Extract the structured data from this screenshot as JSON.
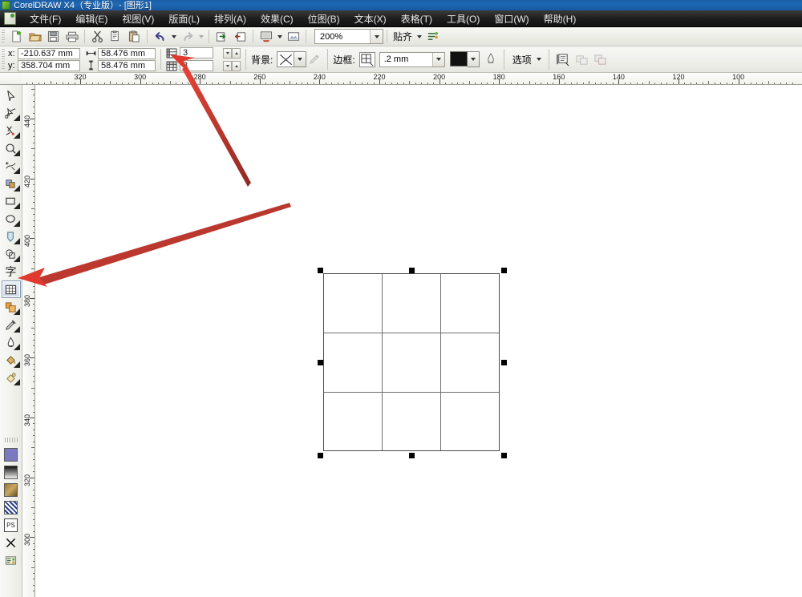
{
  "window": {
    "title": "CorelDRAW X4（专业版）- [图形1]",
    "app_icon": "coreldraw-icon",
    "titlebar_color": "#1f68b4"
  },
  "menubar": {
    "items": [
      {
        "label": "文件(F)",
        "name": "menu-file"
      },
      {
        "label": "编辑(E)",
        "name": "menu-edit"
      },
      {
        "label": "视图(V)",
        "name": "menu-view"
      },
      {
        "label": "版面(L)",
        "name": "menu-layout"
      },
      {
        "label": "排列(A)",
        "name": "menu-arrange"
      },
      {
        "label": "效果(C)",
        "name": "menu-effects"
      },
      {
        "label": "位图(B)",
        "name": "menu-bitmaps"
      },
      {
        "label": "文本(X)",
        "name": "menu-text"
      },
      {
        "label": "表格(T)",
        "name": "menu-table"
      },
      {
        "label": "工具(O)",
        "name": "menu-tools"
      },
      {
        "label": "窗口(W)",
        "name": "menu-window"
      },
      {
        "label": "帮助(H)",
        "name": "menu-help"
      }
    ]
  },
  "toolbar": {
    "buttons": [
      {
        "name": "new-document-button",
        "icon": "new-doc-icon"
      },
      {
        "name": "open-document-button",
        "icon": "folder-open-icon"
      },
      {
        "name": "save-button",
        "icon": "floppy-disk-icon"
      },
      {
        "name": "print-button",
        "icon": "printer-icon"
      },
      {
        "name": "cut-button",
        "icon": "scissors-icon"
      },
      {
        "name": "copy-button",
        "icon": "copy-icon"
      },
      {
        "name": "paste-button",
        "icon": "paste-icon"
      },
      {
        "name": "undo-button",
        "icon": "undo-arrow-icon"
      },
      {
        "name": "redo-button",
        "icon": "redo-arrow-icon"
      },
      {
        "name": "import-button",
        "icon": "import-icon"
      },
      {
        "name": "export-button",
        "icon": "export-icon"
      },
      {
        "name": "application-launcher-button",
        "icon": "launcher-icon"
      },
      {
        "name": "corel-online-button",
        "icon": "corel-online-icon"
      }
    ],
    "zoom_level": "200%",
    "snap_label": "贴齐",
    "options_icon": "snap-options-icon"
  },
  "propertybar": {
    "x_label": "x:",
    "x_value": "-210.637 mm",
    "y_label": "y:",
    "y_value": "358.704 mm",
    "width_icon": "object-width-icon",
    "width_value": "58.476 mm",
    "height_icon": "object-height-icon",
    "height_value": "58.476 mm",
    "rows_icon": "table-rows-icon",
    "rows_value": "3",
    "columns_icon": "table-columns-icon",
    "columns_value": "3",
    "background_label": "背景:",
    "background_fill": "none",
    "background_eyedropper_icon": "fill-eyedropper-icon",
    "border_label": "边框:",
    "border_select_icon": "border-select-icon",
    "border_width_value": ".2 mm",
    "border_color": "#111111",
    "border_eyedropper_icon": "outline-pen-icon",
    "options_label": "选项",
    "text_wrap_icon": "text-wrap-icon",
    "dim1_icon": "convert-to-curves-icon",
    "dim2_icon": "duplicate-icon"
  },
  "hruler": {
    "labels": [
      "320",
      "300",
      "280",
      "260",
      "240",
      "220",
      "200",
      "180",
      "160",
      "140",
      "120",
      "100"
    ],
    "unit": "mm",
    "direction": "right-to-left-decreasing"
  },
  "vruler": {
    "labels": [
      "440",
      "420",
      "400",
      "380",
      "360",
      "340",
      "320",
      "300"
    ],
    "unit": "mm",
    "direction": "top-to-bottom-decreasing"
  },
  "toolbox": {
    "tools": [
      {
        "name": "pick-tool",
        "icon": "arrow-cursor-icon",
        "flyout": false,
        "active": false
      },
      {
        "name": "shape-tool",
        "icon": "node-edit-icon",
        "flyout": true,
        "active": false
      },
      {
        "name": "crop-tool",
        "icon": "crop-knife-icon",
        "flyout": true,
        "active": false
      },
      {
        "name": "zoom-tool",
        "icon": "magnifier-icon",
        "flyout": true,
        "active": false
      },
      {
        "name": "freehand-tool",
        "icon": "freehand-curve-icon",
        "flyout": true,
        "active": false
      },
      {
        "name": "smart-fill-tool",
        "icon": "smart-fill-icon",
        "flyout": true,
        "active": false
      },
      {
        "name": "rectangle-tool",
        "icon": "rectangle-icon",
        "flyout": true,
        "active": false
      },
      {
        "name": "ellipse-tool",
        "icon": "ellipse-icon",
        "flyout": true,
        "active": false
      },
      {
        "name": "polygon-tool",
        "icon": "polygon-icon",
        "flyout": true,
        "active": false
      },
      {
        "name": "basic-shapes-tool",
        "icon": "basic-shapes-icon",
        "flyout": true,
        "active": false
      },
      {
        "name": "text-tool",
        "icon": "text-character-icon",
        "flyout": false,
        "active": false
      },
      {
        "name": "table-tool",
        "icon": "table-grid-icon",
        "flyout": false,
        "active": true
      },
      {
        "name": "blend-tool",
        "icon": "blend-icon",
        "flyout": true,
        "active": false
      },
      {
        "name": "eyedropper-tool",
        "icon": "eyedropper-icon",
        "flyout": true,
        "active": false
      },
      {
        "name": "outline-tool",
        "icon": "outline-pen-icon",
        "flyout": true,
        "active": false
      },
      {
        "name": "fill-tool",
        "icon": "paint-bucket-icon",
        "flyout": true,
        "active": false
      },
      {
        "name": "interactive-fill-tool",
        "icon": "interactive-fill-icon",
        "flyout": true,
        "active": false
      }
    ],
    "swatches": [
      {
        "name": "uniform-fill-swatch",
        "icon": "uniform-fill-icon",
        "color": "#7b79bf"
      },
      {
        "name": "fountain-fill-swatch",
        "icon": "fountain-fill-icon",
        "color": "#2b2b2b"
      },
      {
        "name": "pattern-fill-swatch",
        "icon": "pattern-fill-icon",
        "color": "#8a6a33"
      },
      {
        "name": "texture-fill-swatch",
        "icon": "texture-fill-icon",
        "color": "#2b3f8c"
      },
      {
        "name": "postscript-fill-swatch",
        "icon": "postscript-fill-icon",
        "color": "#555555"
      },
      {
        "name": "no-fill-swatch",
        "icon": "no-fill-x-icon",
        "color": "#000000"
      },
      {
        "name": "color-docker-swatch",
        "icon": "color-docker-icon",
        "color": "#3a7a3a"
      }
    ]
  },
  "canvas": {
    "table_object": {
      "name": "table-object",
      "rows": 3,
      "columns": 3,
      "selected": true,
      "border_color": "#4a4a4a",
      "gridline_color": "#6e6e6e",
      "fill": "none"
    },
    "handles_count": 8
  },
  "annotations": [
    {
      "name": "arrow-to-rows-columns-spinner",
      "color": "#e03a30",
      "target": "rows-columns-field"
    },
    {
      "name": "arrow-to-table-tool",
      "color": "#e03a30",
      "target": "table-tool"
    }
  ]
}
